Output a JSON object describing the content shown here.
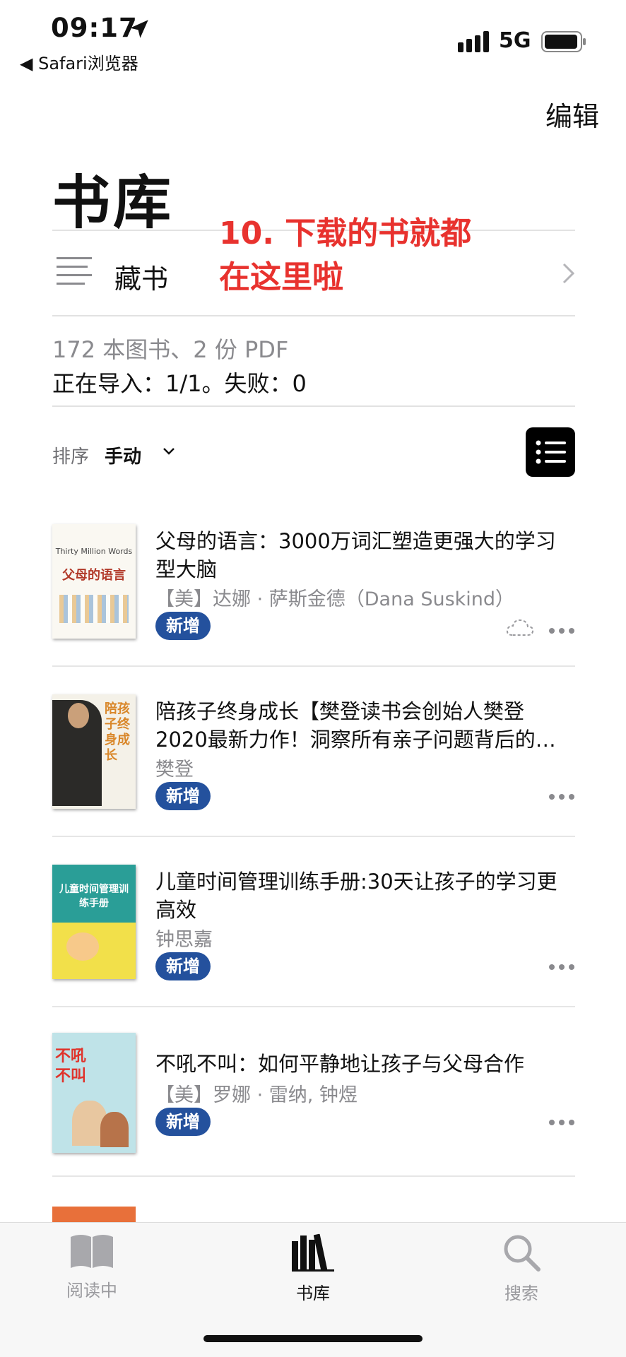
{
  "status_bar": {
    "time": "09:17",
    "back_app": "◀ Safari浏览器",
    "network": "5G"
  },
  "header": {
    "edit_label": "编辑",
    "title": "书库"
  },
  "collection": {
    "label": "藏书"
  },
  "annotation": {
    "line1": "10. 下载的书就都",
    "line2": "在这里啦"
  },
  "library_info": {
    "count_text": "172 本图书、2 份 PDF",
    "import_text": "正在导入：1/1。失败：0"
  },
  "sort": {
    "label": "排序",
    "value": "手动"
  },
  "books": [
    {
      "title_line1": "父母的语言：3000万词汇塑造更强大的学习",
      "title_line2": "型大脑",
      "author": "【美】达娜 · 萨斯金德（Dana Suskind）",
      "badge": "新增",
      "cover_text": "父母的语言",
      "cover_sub": "Thirty Million Words"
    },
    {
      "title_line1": "陪孩子终身成长【樊登读书会创始人樊登",
      "title_line2": "2020最新力作！洞察所有亲子问题背后的…",
      "author": "樊登",
      "badge": "新增",
      "cover_text": "陪孩子终身成长"
    },
    {
      "title_line1": "儿童时间管理训练手册:30天让孩子的学习更",
      "title_line2": "高效",
      "author": "钟思嘉",
      "badge": "新增",
      "cover_text": "儿童时间管理训练手册"
    },
    {
      "title_line1": "不吼不叫：如何平静地让孩子与父母合作",
      "title_line2": "",
      "author": "【美】罗娜 · 雷纳, 钟煜",
      "badge": "新增",
      "cover_text": "不吼不叫"
    }
  ],
  "tabs": [
    {
      "label": "阅读中",
      "icon": "book-open-icon"
    },
    {
      "label": "书库",
      "icon": "library-icon"
    },
    {
      "label": "搜索",
      "icon": "search-icon"
    }
  ],
  "colors": {
    "badge": "#24519d",
    "annotation": "#e8322e",
    "secondary_text": "#8a8a8e"
  }
}
